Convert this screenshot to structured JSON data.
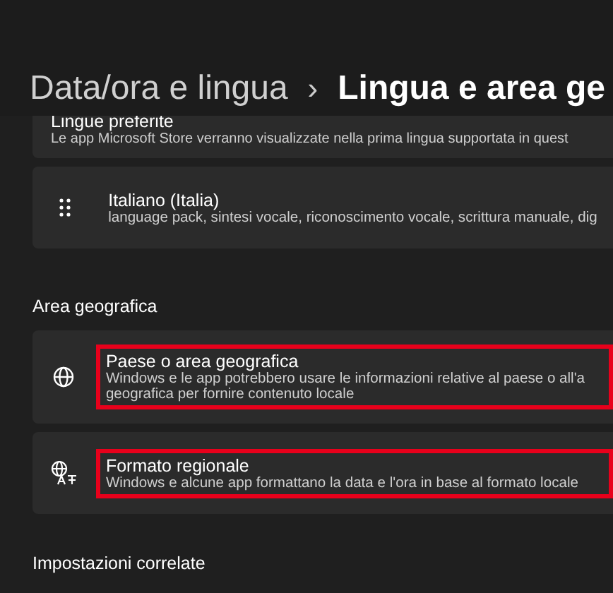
{
  "breadcrumb": {
    "parent": "Data/ora e lingua",
    "separator": "›",
    "current": "Lingua e area ge"
  },
  "language_card": {
    "title": "Lingue preferite",
    "description": "Le app Microsoft Store verranno visualizzate nella prima lingua supportata in quest"
  },
  "languages": [
    {
      "name": "Italiano (Italia)",
      "features": "language pack, sintesi vocale, riconoscimento vocale, scrittura manuale, dig"
    }
  ],
  "region_section": {
    "heading": "Area geografica",
    "items": [
      {
        "kind": "globe",
        "title": "Paese o area geografica",
        "description": "Windows e le app potrebbero usare le informazioni relative al paese o all'a geografica per fornire contenuto locale",
        "highlighted": true
      },
      {
        "kind": "format",
        "title": "Formato regionale",
        "description": "Windows e alcune app formattano la data e l'ora in base al formato locale",
        "highlighted": true
      }
    ]
  },
  "related_heading": "Impostazioni correlate"
}
